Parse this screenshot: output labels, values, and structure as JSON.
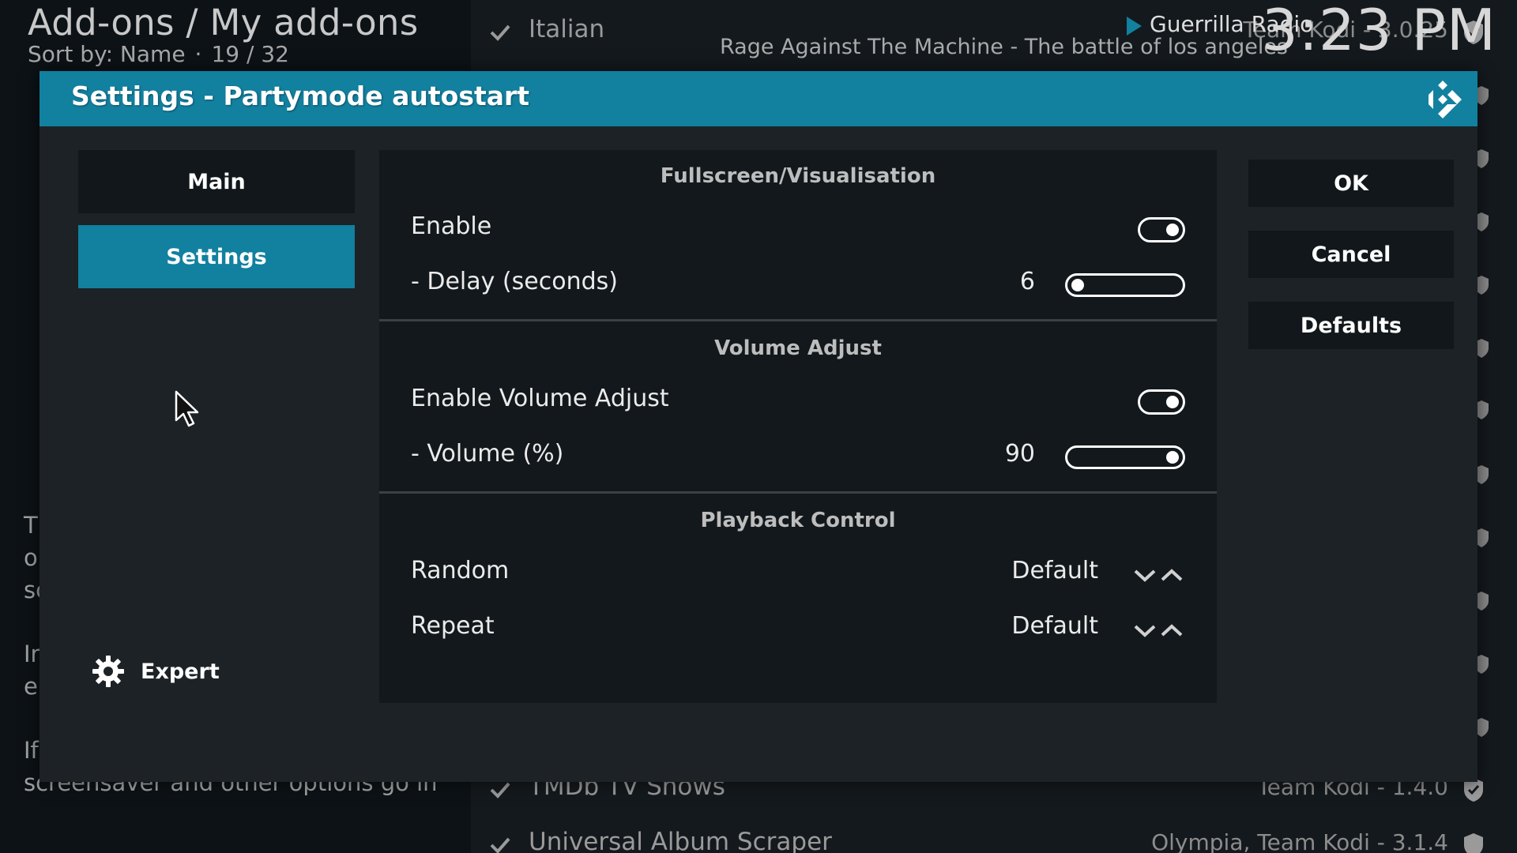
{
  "background": {
    "title": "Add-ons / My add-ons",
    "sort_label": "Sort by: Name",
    "sort_separator": "·",
    "position": "19 / 32",
    "description_lines": [
      "Tl",
      "o",
      "sc",
      "Ir",
      "er",
      "If",
      "screensaver and other options go in"
    ],
    "addons": [
      {
        "name": "Italian",
        "meta": "Team Kodi - 3.0.25"
      },
      {
        "name": "TMDb TV Shows",
        "meta": "Team Kodi - 1.4.0"
      },
      {
        "name": "Universal Album Scraper",
        "meta": "Olympia, Team Kodi - 3.1.4"
      }
    ]
  },
  "now_playing": {
    "title": "Guerrilla Radio",
    "artist_album": "Rage Against The Machine - The battle of los angeles",
    "clock": "3:23 PM"
  },
  "dialog": {
    "title": "Settings - Partymode autostart",
    "categories": [
      {
        "label": "Main",
        "selected": false
      },
      {
        "label": "Settings",
        "selected": true
      }
    ],
    "expert_label": "Expert",
    "sections": {
      "fullscreen": {
        "title": "Fullscreen/Visualisation",
        "enable_label": "Enable",
        "enable_on": true,
        "delay_label": "- Delay (seconds)",
        "delay_value": "6",
        "delay_fraction": 0.0
      },
      "volume": {
        "title": "Volume Adjust",
        "enable_label": "Enable Volume Adjust",
        "enable_on": true,
        "volume_label": "- Volume (%)",
        "volume_value": "90",
        "volume_fraction": 1.0
      },
      "playback": {
        "title": "Playback Control",
        "random_label": "Random",
        "random_value": "Default",
        "repeat_label": "Repeat",
        "repeat_value": "Default"
      }
    },
    "buttons": {
      "ok": "OK",
      "cancel": "Cancel",
      "defaults": "Defaults"
    }
  },
  "colors": {
    "accent": "#12809f",
    "panel": "#12181b",
    "dialog": "#1c2226"
  },
  "icons": {
    "check": "check-icon",
    "shield": "shield-icon",
    "play": "play-icon",
    "kodi": "kodi-logo-icon",
    "gear": "gear-icon",
    "spinner": "chevron-down-up-icon",
    "cursor": "mouse-pointer-icon"
  }
}
